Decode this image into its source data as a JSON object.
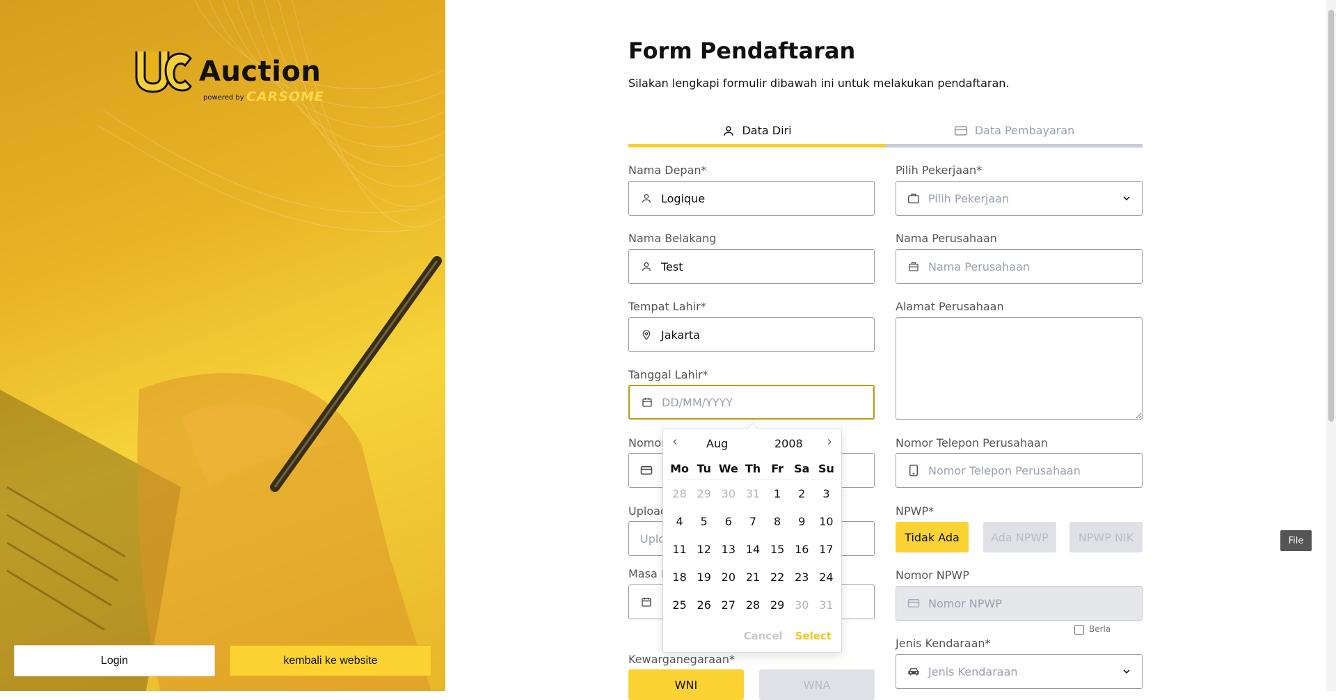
{
  "brand": {
    "name": "Auction",
    "powered_by": "powered by",
    "partner": "CARSOME"
  },
  "left_buttons": {
    "login": "Login",
    "back": "kembali ke website"
  },
  "form": {
    "title": "Form Pendaftaran",
    "subtitle": "Silakan lengkapi formulir dibawah ini untuk melakukan pendaftaran.",
    "tabs": [
      {
        "label": "Data Diri",
        "icon": "user-icon",
        "active": true
      },
      {
        "label": "Data Pembayaran",
        "icon": "card-icon",
        "active": false
      }
    ],
    "left_col": {
      "nama_depan": {
        "label": "Nama Depan*",
        "value": "Logique"
      },
      "nama_belakang": {
        "label": "Nama Belakang",
        "value": "Test"
      },
      "tempat_lahir": {
        "label": "Tempat Lahir*",
        "value": "Jakarta"
      },
      "tanggal_lahir": {
        "label": "Tanggal Lahir*",
        "placeholder": "DD/MM/YYYY"
      },
      "nomor": {
        "label": "Nomor"
      },
      "upload": {
        "label": "Upload",
        "placeholder": "Uplo",
        "button": "File"
      },
      "masa": {
        "label": "Masa B"
      },
      "berlaku": {
        "label": "Berla"
      },
      "kewarganegaraan": {
        "label": "Kewarganegaraan*",
        "options": [
          "WNI",
          "WNA"
        ]
      }
    },
    "right_col": {
      "pekerjaan": {
        "label": "Pilih Pekerjaan*",
        "placeholder": "Pilih Pekerjaan"
      },
      "nama_perusahaan": {
        "label": "Nama Perusahaan",
        "placeholder": "Nama Perusahaan"
      },
      "alamat_perusahaan": {
        "label": "Alamat Perusahaan"
      },
      "telepon_perusahaan": {
        "label": "Nomor Telepon Perusahaan",
        "placeholder": "Nomor Telepon Perusahaan"
      },
      "npwp": {
        "label": "NPWP*",
        "options": [
          "Tidak Ada",
          "Ada NPWP",
          "NPWP NIK"
        ]
      },
      "nomor_npwp": {
        "label": "Nomor NPWP",
        "placeholder": "Nomor NPWP"
      },
      "jenis_kendaraan": {
        "label": "Jenis Kendaraan*",
        "placeholder": "Jenis Kendaraan"
      }
    }
  },
  "calendar": {
    "month": "Aug",
    "year": "2008",
    "weekdays": [
      "Mo",
      "Tu",
      "We",
      "Th",
      "Fr",
      "Sa",
      "Su"
    ],
    "weeks": [
      [
        {
          "d": "28",
          "m": true
        },
        {
          "d": "29",
          "m": true
        },
        {
          "d": "30",
          "m": true
        },
        {
          "d": "31",
          "m": true
        },
        {
          "d": "1"
        },
        {
          "d": "2"
        },
        {
          "d": "3"
        }
      ],
      [
        {
          "d": "4"
        },
        {
          "d": "5"
        },
        {
          "d": "6"
        },
        {
          "d": "7"
        },
        {
          "d": "8"
        },
        {
          "d": "9"
        },
        {
          "d": "10"
        }
      ],
      [
        {
          "d": "11"
        },
        {
          "d": "12"
        },
        {
          "d": "13"
        },
        {
          "d": "14"
        },
        {
          "d": "15"
        },
        {
          "d": "16"
        },
        {
          "d": "17"
        }
      ],
      [
        {
          "d": "18"
        },
        {
          "d": "19"
        },
        {
          "d": "20"
        },
        {
          "d": "21"
        },
        {
          "d": "22"
        },
        {
          "d": "23"
        },
        {
          "d": "24"
        }
      ],
      [
        {
          "d": "25"
        },
        {
          "d": "26"
        },
        {
          "d": "27"
        },
        {
          "d": "28"
        },
        {
          "d": "29"
        },
        {
          "d": "30",
          "m": true
        },
        {
          "d": "31",
          "m": true
        }
      ]
    ],
    "cancel": "Cancel",
    "select": "Select"
  },
  "colors": {
    "accent": "#fdd334",
    "tab_active": "#f5cf3a",
    "select_text": "#f3c623"
  }
}
